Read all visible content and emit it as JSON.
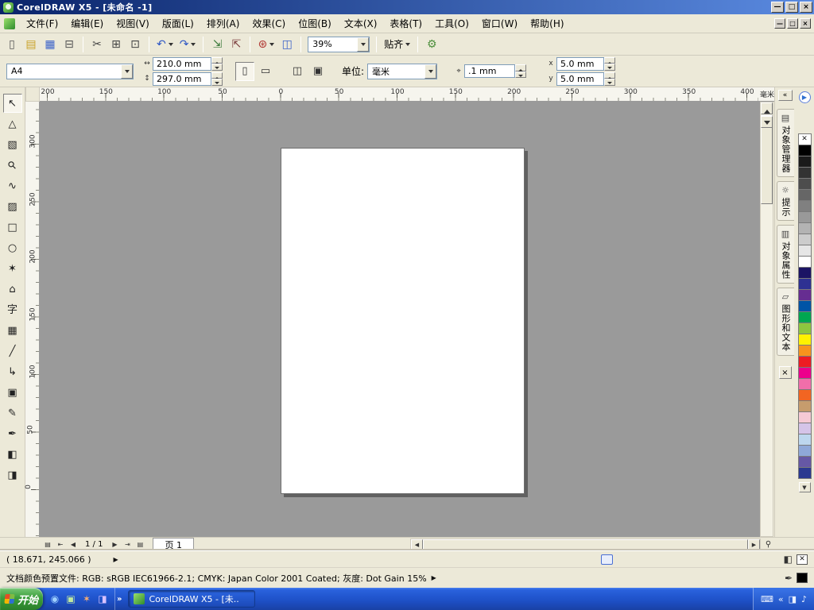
{
  "colors": {
    "titlebar_left": "#0a246a",
    "titlebar_right": "#5a8ae0",
    "chrome": "#ece9d8",
    "canvas_bg": "#9a9a9a",
    "start_green": "#3b9e3b"
  },
  "titlebar": {
    "title": "CorelDRAW X5 - [未命名 -1]",
    "buttons": {
      "minimize": "—",
      "maximize": "□",
      "close": "×"
    }
  },
  "menubar": {
    "items": [
      "文件(F)",
      "编辑(E)",
      "视图(V)",
      "版面(L)",
      "排列(A)",
      "效果(C)",
      "位图(B)",
      "文本(X)",
      "表格(T)",
      "工具(O)",
      "窗口(W)",
      "帮助(H)"
    ],
    "window_buttons": {
      "minimize": "—",
      "restore": "□",
      "close": "×"
    }
  },
  "toolbar": {
    "items": [
      {
        "t": "btn",
        "name": "new-document",
        "g": "▯",
        "c": "#555555"
      },
      {
        "t": "btn",
        "name": "open-document",
        "g": "▤",
        "c": "#c9a227"
      },
      {
        "t": "btn",
        "name": "save-document",
        "g": "▦",
        "c": "#3a62c9"
      },
      {
        "t": "btn",
        "name": "print",
        "g": "⊟",
        "c": "#555555"
      },
      {
        "t": "sep"
      },
      {
        "t": "btn",
        "name": "cut",
        "g": "✂",
        "c": "#444444"
      },
      {
        "t": "btn",
        "name": "copy",
        "g": "⊞",
        "c": "#444444"
      },
      {
        "t": "btn",
        "name": "paste",
        "g": "⊡",
        "c": "#444444"
      },
      {
        "t": "sep"
      },
      {
        "t": "btn",
        "name": "undo",
        "g": "↶",
        "c": "#2e57c4",
        "dd": true
      },
      {
        "t": "btn",
        "name": "redo",
        "g": "↷",
        "c": "#2e57c4",
        "dd": true
      },
      {
        "t": "sep"
      },
      {
        "t": "btn",
        "name": "import",
        "g": "⇲",
        "c": "#3b7a3b"
      },
      {
        "t": "btn",
        "name": "export",
        "g": "⇱",
        "c": "#7a3b3b"
      },
      {
        "t": "sep"
      },
      {
        "t": "btn",
        "name": "application-launcher",
        "g": "⊛",
        "c": "#b0342f",
        "dd": true
      },
      {
        "t": "btn",
        "name": "welcome-screen",
        "g": "◫",
        "c": "#3a62c9"
      },
      {
        "t": "sep"
      },
      {
        "t": "combo",
        "name": "zoom-level",
        "value": "39%"
      },
      {
        "t": "sep"
      },
      {
        "t": "dropdown",
        "name": "snap-to",
        "label": "贴齐"
      },
      {
        "t": "sep"
      },
      {
        "t": "btn",
        "name": "options",
        "g": "⚙",
        "c": "#4d8f3c"
      }
    ]
  },
  "property_bar": {
    "paper_size": "A4",
    "paper_width": "210.0 mm",
    "paper_height": "297.0 mm",
    "units_label": "单位:",
    "units_value": "毫米",
    "nudge_value": ".1 mm",
    "duplicate_x": "5.0 mm",
    "duplicate_y": "5.0 mm",
    "icons": {
      "width": "↔",
      "height": "↕",
      "portrait": "▯",
      "landscape": "▭",
      "all_pages": "◫",
      "current_page": "▣",
      "nudge": "⌖",
      "dup_x": "x",
      "dup_y": "y"
    }
  },
  "rulers": {
    "h_labels": [
      "200",
      "150",
      "100",
      "50",
      "0",
      "50",
      "100",
      "150",
      "200",
      "250",
      "300",
      "350",
      "400"
    ],
    "unit": "毫米",
    "v_labels": [
      "300",
      "250",
      "200",
      "150",
      "100",
      "50",
      "0"
    ]
  },
  "toolbox": {
    "tools": [
      {
        "name": "pick-tool",
        "g": "↖",
        "active": true
      },
      {
        "name": "shape-tool",
        "g": "△"
      },
      {
        "name": "crop-tool",
        "g": "▧"
      },
      {
        "name": "zoom-tool",
        "g": "⚲"
      },
      {
        "name": "freehand-tool",
        "g": "∿"
      },
      {
        "name": "smart-fill-tool",
        "g": "▨"
      },
      {
        "name": "rectangle-tool",
        "g": "□"
      },
      {
        "name": "ellipse-tool",
        "g": "○"
      },
      {
        "name": "polygon-tool",
        "g": "✶"
      },
      {
        "name": "basic-shapes-tool",
        "g": "⌂"
      },
      {
        "name": "text-tool",
        "g": "字"
      },
      {
        "name": "table-tool",
        "g": "▦"
      },
      {
        "name": "dimension-tool",
        "g": "╱"
      },
      {
        "name": "connector-tool",
        "g": "↳"
      },
      {
        "name": "blend-tool",
        "g": "▣"
      },
      {
        "name": "eyedropper-tool",
        "g": "✎"
      },
      {
        "name": "outline-pen-tool",
        "g": "✒"
      },
      {
        "name": "fill-tool",
        "g": "◧"
      },
      {
        "name": "interactive-fill-tool",
        "g": "◨"
      }
    ]
  },
  "dockers": {
    "collapse": "«",
    "tabs": [
      {
        "name": "object-manager",
        "icon": "▤",
        "label": "对象管理器"
      },
      {
        "name": "hints",
        "icon": "☼",
        "label": "提示"
      },
      {
        "name": "object-properties",
        "icon": "▥",
        "label": "对象属性"
      },
      {
        "name": "graphics-and-text",
        "icon": "▱",
        "label": "图形和文本"
      }
    ],
    "close": "×"
  },
  "palette": {
    "expand": "▶",
    "none": "✕",
    "scroll_down": "▼",
    "colors": [
      "#000000",
      "#1a1a1a",
      "#333333",
      "#4d4d4d",
      "#666666",
      "#808080",
      "#999999",
      "#b3b3b3",
      "#cccccc",
      "#e6e6e6",
      "#ffffff",
      "#1b1464",
      "#2e3192",
      "#662d91",
      "#0054a6",
      "#00a651",
      "#8dc63f",
      "#fff200",
      "#f7941d",
      "#ed1c24",
      "#ec008c",
      "#f06eaa",
      "#f26522",
      "#c69c6d",
      "#f5c9d4",
      "#d5c4e8",
      "#bdd7ee",
      "#8fa8d8",
      "#6658a5",
      "#2b3990"
    ]
  },
  "page_bar": {
    "add_page_front": "▤",
    "first": "⇤",
    "prev": "◀",
    "indicator": "1 / 1",
    "next": "▶",
    "last": "⇥",
    "add_page_back": "▤",
    "tab_label": "页 1",
    "scroll_left": "◀",
    "scroll_right": "▶",
    "nav_zoom": "⚲"
  },
  "status": {
    "coordinates": "( 18.671, 245.066 )",
    "flyout": "▶",
    "profile": "文档颜色预置文件: RGB: sRGB IEC61966-2.1; CMYK: Japan Color 2001 Coated; 灰度: Dot Gain 15%",
    "fill_icon": "◧",
    "no_fill_glyph": "✕",
    "outline_icon": "✒",
    "outline_color": "#000000"
  },
  "taskbar": {
    "start_label": "开始",
    "quick_launch": [
      {
        "name": "browser-icon",
        "g": "◉",
        "c": "#9fd0ff"
      },
      {
        "name": "show-desktop-icon",
        "g": "▣",
        "c": "#bfe8a0"
      },
      {
        "name": "firefox-icon",
        "g": "✶",
        "c": "#ffb070"
      },
      {
        "name": "media-player-icon",
        "g": "◨",
        "c": "#d9c2ff"
      }
    ],
    "more": "»",
    "task_label": "CorelDRAW X5 - [未..",
    "tray": [
      {
        "name": "input-method-icon",
        "g": "⌨"
      },
      {
        "name": "tray-collapse-icon",
        "g": "«"
      },
      {
        "name": "display-icon",
        "g": "◨"
      },
      {
        "name": "volume-icon",
        "g": "♪"
      }
    ]
  }
}
